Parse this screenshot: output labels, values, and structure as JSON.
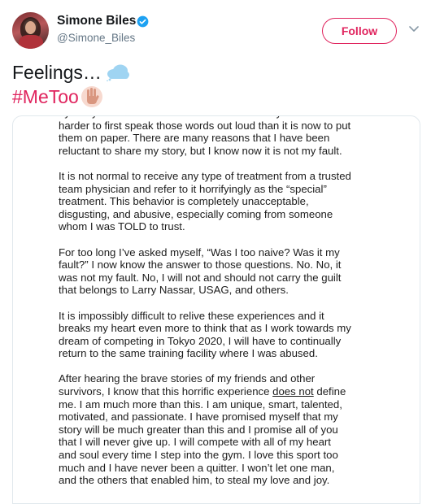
{
  "user": {
    "name": "Simone Biles",
    "handle": "@Simone_Biles",
    "verified": true
  },
  "actions": {
    "follow_label": "Follow"
  },
  "tweet": {
    "text_line1": "Feelings…",
    "hashtag": "#MeToo",
    "emojis": [
      "cloud-emoji",
      "hand-emoji"
    ]
  },
  "letter": {
    "p0": "by Larry Nassar. Please believe me when I say it was a lot\nharder to first speak those words out loud than it is now to put\nthem on paper. There are many reasons that I have been\nreluctant to share my story, but I know now it is not my fault.",
    "p1": "It is not normal to receive any type of treatment from a trusted\nteam physician and refer to it horrifyingly as the “special”\ntreatment. This behavior is completely unacceptable,\ndisgusting, and abusive, especially coming from someone\nwhom I was TOLD to trust.",
    "p2": "For too long I’ve asked myself, “Was I too naive? Was it my\nfault?” I now know the answer to those questions.  No.  No, it\nwas not my fault.  No, I will not and should not carry the guilt\nthat belongs to Larry Nassar, USAG, and others.",
    "p3": "It is impossibly difficult to relive these experiences and it\nbreaks my heart even more to think that as I work towards my\ndream of competing in Tokyo 2020, I will have to continually\nreturn to the same training facility where I was abused.",
    "p4_a": "After hearing the brave stories of my friends and other\nsurvivors, I know that this horrific experience ",
    "p4_u": "does not",
    "p4_b": " define\nme. I am much more than this. I am unique, smart, talented,\nmotivated, and passionate. I have promised myself that my\nstory will be much greater than this and I promise all of you\nthat I will never give up.  I will compete with all of my heart\nand soul every time I step into the gym. I love this sport too\nmuch and I have never been a quitter. I won’t let one man,\nand the others that enabled him, to steal my love and joy."
  },
  "colors": {
    "accent": "#e0245e",
    "verified": "#1da1f2",
    "handle": "#657786"
  }
}
